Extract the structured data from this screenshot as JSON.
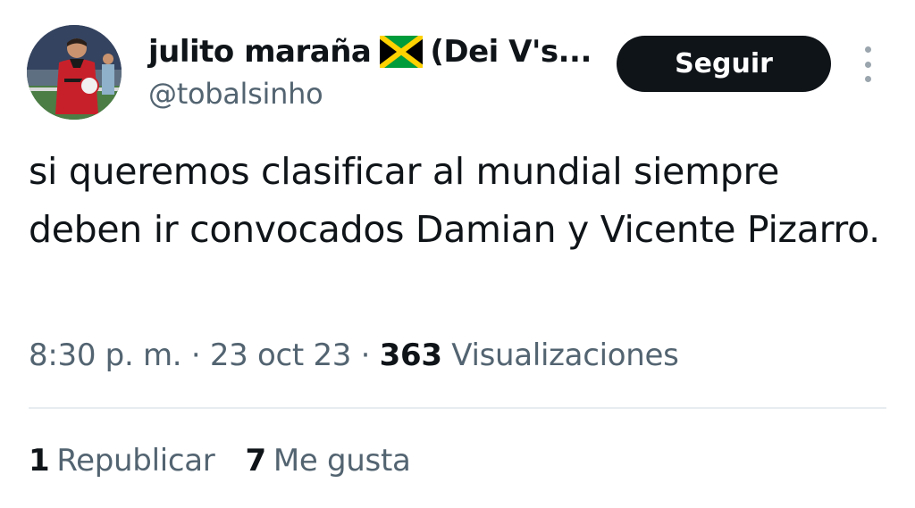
{
  "author": {
    "display_name": "julito maraña",
    "display_name_suffix": "(Dei V's...",
    "flag_icon": "jamaica-flag-icon",
    "handle": "@tobalsinho",
    "avatar_icon": "profile-photo"
  },
  "actions": {
    "follow_label": "Seguir",
    "more_icon": "more-options-icon"
  },
  "tweet": {
    "text": "si queremos clasificar al mundial siempre deben ir convocados Damian y Vicente Pizarro."
  },
  "meta": {
    "time": "8:30 p. m.",
    "separator": "·",
    "date": "23 oct 23",
    "views_count": "363",
    "views_label": "Visualizaciones"
  },
  "stats": {
    "reposts_count": "1",
    "reposts_label": "Republicar",
    "likes_count": "7",
    "likes_label": "Me gusta"
  },
  "colors": {
    "text_primary": "#0f1419",
    "text_secondary": "#536471",
    "button_bg": "#0f1419",
    "divider": "#e6ecf0"
  }
}
